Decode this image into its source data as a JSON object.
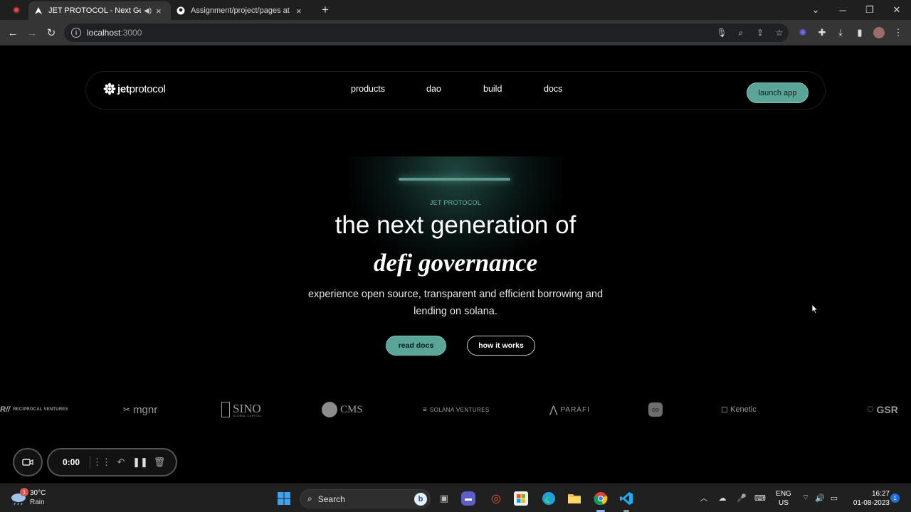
{
  "browser": {
    "tabs": [
      {
        "title": "JET PROTOCOL - Next Generation of DeFi Governance",
        "icon": "jet-favicon",
        "muted_icon": "speaker-icon"
      },
      {
        "title": "Assignment/project/pages at main",
        "icon": "github-icon"
      }
    ],
    "url_host": "localhost",
    "url_port": ":3000"
  },
  "nav": {
    "logo_bold": "jet",
    "logo_regular": "protocol",
    "links": [
      "products",
      "dao",
      "build",
      "docs"
    ],
    "cta": "launch app"
  },
  "hero": {
    "eyebrow": "JET PROTOCOL",
    "headline": "the next generation of",
    "headline_em": "defi governance",
    "subtitle": "experience open source, transparent and efficient borrowing and lending on solana.",
    "primary_button": "read docs",
    "secondary_button": "how it works"
  },
  "partners": [
    {
      "name": "RECIPROCAL VENTURES",
      "mark": "R//"
    },
    {
      "name": "mgnr",
      "mark": "✂"
    },
    {
      "name": "SINO",
      "sub": "GLOBAL CAPITAL"
    },
    {
      "name": "CMS"
    },
    {
      "name": "SOLANA VENTURES",
      "mark": "≡"
    },
    {
      "name": "PARAFI"
    },
    {
      "name": "robot-logo"
    },
    {
      "name": "Kenetic"
    },
    {
      "name": "GSR"
    }
  ],
  "recorder": {
    "time": "0:00"
  },
  "taskbar": {
    "temperature": "30°C",
    "condition": "Rain",
    "weather_badge": "1",
    "search_label": "Search",
    "lang_top": "ENG",
    "lang_bottom": "US",
    "time": "16:27",
    "date": "01-08-2023",
    "notification_count": "1"
  },
  "colors": {
    "accent": "#5aa597",
    "background": "#000000"
  }
}
